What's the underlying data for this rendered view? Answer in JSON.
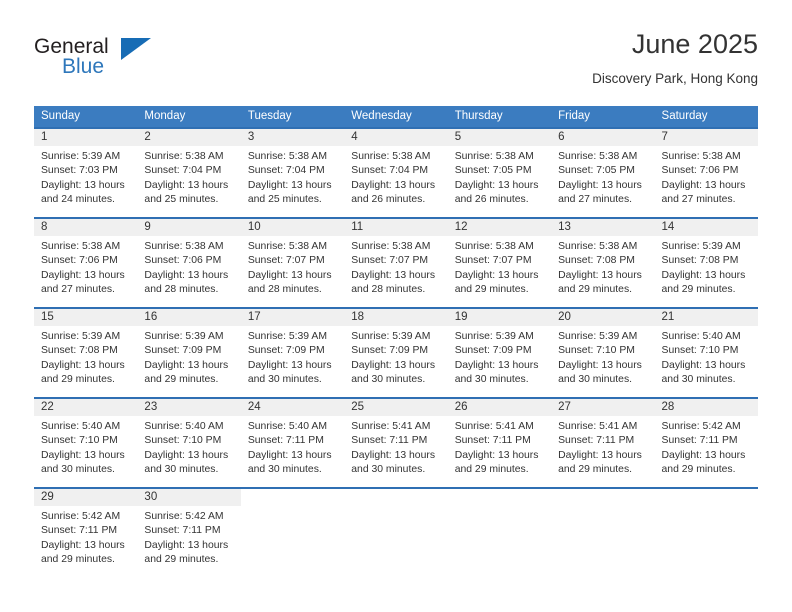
{
  "brand": {
    "name_part1": "General",
    "name_part2": "Blue",
    "triangle_color": "#176cb5",
    "blue_color": "#2e77bb"
  },
  "header": {
    "title": "June 2025",
    "subtitle": "Discovery Park, Hong Kong"
  },
  "theme": {
    "header_bg": "#3b7cc0",
    "row_divider": "#2f6fb3",
    "daynum_band_bg": "#f0f0f0",
    "text": "#333333"
  },
  "weekday_headers": [
    "Sunday",
    "Monday",
    "Tuesday",
    "Wednesday",
    "Thursday",
    "Friday",
    "Saturday"
  ],
  "weeks": [
    {
      "days": [
        {
          "date": "1",
          "sunrise": "Sunrise: 5:39 AM",
          "sunset": "Sunset: 7:03 PM",
          "daylight_line1": "Daylight: 13 hours",
          "daylight_line2": "and 24 minutes."
        },
        {
          "date": "2",
          "sunrise": "Sunrise: 5:38 AM",
          "sunset": "Sunset: 7:04 PM",
          "daylight_line1": "Daylight: 13 hours",
          "daylight_line2": "and 25 minutes."
        },
        {
          "date": "3",
          "sunrise": "Sunrise: 5:38 AM",
          "sunset": "Sunset: 7:04 PM",
          "daylight_line1": "Daylight: 13 hours",
          "daylight_line2": "and 25 minutes."
        },
        {
          "date": "4",
          "sunrise": "Sunrise: 5:38 AM",
          "sunset": "Sunset: 7:04 PM",
          "daylight_line1": "Daylight: 13 hours",
          "daylight_line2": "and 26 minutes."
        },
        {
          "date": "5",
          "sunrise": "Sunrise: 5:38 AM",
          "sunset": "Sunset: 7:05 PM",
          "daylight_line1": "Daylight: 13 hours",
          "daylight_line2": "and 26 minutes."
        },
        {
          "date": "6",
          "sunrise": "Sunrise: 5:38 AM",
          "sunset": "Sunset: 7:05 PM",
          "daylight_line1": "Daylight: 13 hours",
          "daylight_line2": "and 27 minutes."
        },
        {
          "date": "7",
          "sunrise": "Sunrise: 5:38 AM",
          "sunset": "Sunset: 7:06 PM",
          "daylight_line1": "Daylight: 13 hours",
          "daylight_line2": "and 27 minutes."
        }
      ]
    },
    {
      "days": [
        {
          "date": "8",
          "sunrise": "Sunrise: 5:38 AM",
          "sunset": "Sunset: 7:06 PM",
          "daylight_line1": "Daylight: 13 hours",
          "daylight_line2": "and 27 minutes."
        },
        {
          "date": "9",
          "sunrise": "Sunrise: 5:38 AM",
          "sunset": "Sunset: 7:06 PM",
          "daylight_line1": "Daylight: 13 hours",
          "daylight_line2": "and 28 minutes."
        },
        {
          "date": "10",
          "sunrise": "Sunrise: 5:38 AM",
          "sunset": "Sunset: 7:07 PM",
          "daylight_line1": "Daylight: 13 hours",
          "daylight_line2": "and 28 minutes."
        },
        {
          "date": "11",
          "sunrise": "Sunrise: 5:38 AM",
          "sunset": "Sunset: 7:07 PM",
          "daylight_line1": "Daylight: 13 hours",
          "daylight_line2": "and 28 minutes."
        },
        {
          "date": "12",
          "sunrise": "Sunrise: 5:38 AM",
          "sunset": "Sunset: 7:07 PM",
          "daylight_line1": "Daylight: 13 hours",
          "daylight_line2": "and 29 minutes."
        },
        {
          "date": "13",
          "sunrise": "Sunrise: 5:38 AM",
          "sunset": "Sunset: 7:08 PM",
          "daylight_line1": "Daylight: 13 hours",
          "daylight_line2": "and 29 minutes."
        },
        {
          "date": "14",
          "sunrise": "Sunrise: 5:39 AM",
          "sunset": "Sunset: 7:08 PM",
          "daylight_line1": "Daylight: 13 hours",
          "daylight_line2": "and 29 minutes."
        }
      ]
    },
    {
      "days": [
        {
          "date": "15",
          "sunrise": "Sunrise: 5:39 AM",
          "sunset": "Sunset: 7:08 PM",
          "daylight_line1": "Daylight: 13 hours",
          "daylight_line2": "and 29 minutes."
        },
        {
          "date": "16",
          "sunrise": "Sunrise: 5:39 AM",
          "sunset": "Sunset: 7:09 PM",
          "daylight_line1": "Daylight: 13 hours",
          "daylight_line2": "and 29 minutes."
        },
        {
          "date": "17",
          "sunrise": "Sunrise: 5:39 AM",
          "sunset": "Sunset: 7:09 PM",
          "daylight_line1": "Daylight: 13 hours",
          "daylight_line2": "and 30 minutes."
        },
        {
          "date": "18",
          "sunrise": "Sunrise: 5:39 AM",
          "sunset": "Sunset: 7:09 PM",
          "daylight_line1": "Daylight: 13 hours",
          "daylight_line2": "and 30 minutes."
        },
        {
          "date": "19",
          "sunrise": "Sunrise: 5:39 AM",
          "sunset": "Sunset: 7:09 PM",
          "daylight_line1": "Daylight: 13 hours",
          "daylight_line2": "and 30 minutes."
        },
        {
          "date": "20",
          "sunrise": "Sunrise: 5:39 AM",
          "sunset": "Sunset: 7:10 PM",
          "daylight_line1": "Daylight: 13 hours",
          "daylight_line2": "and 30 minutes."
        },
        {
          "date": "21",
          "sunrise": "Sunrise: 5:40 AM",
          "sunset": "Sunset: 7:10 PM",
          "daylight_line1": "Daylight: 13 hours",
          "daylight_line2": "and 30 minutes."
        }
      ]
    },
    {
      "days": [
        {
          "date": "22",
          "sunrise": "Sunrise: 5:40 AM",
          "sunset": "Sunset: 7:10 PM",
          "daylight_line1": "Daylight: 13 hours",
          "daylight_line2": "and 30 minutes."
        },
        {
          "date": "23",
          "sunrise": "Sunrise: 5:40 AM",
          "sunset": "Sunset: 7:10 PM",
          "daylight_line1": "Daylight: 13 hours",
          "daylight_line2": "and 30 minutes."
        },
        {
          "date": "24",
          "sunrise": "Sunrise: 5:40 AM",
          "sunset": "Sunset: 7:11 PM",
          "daylight_line1": "Daylight: 13 hours",
          "daylight_line2": "and 30 minutes."
        },
        {
          "date": "25",
          "sunrise": "Sunrise: 5:41 AM",
          "sunset": "Sunset: 7:11 PM",
          "daylight_line1": "Daylight: 13 hours",
          "daylight_line2": "and 30 minutes."
        },
        {
          "date": "26",
          "sunrise": "Sunrise: 5:41 AM",
          "sunset": "Sunset: 7:11 PM",
          "daylight_line1": "Daylight: 13 hours",
          "daylight_line2": "and 29 minutes."
        },
        {
          "date": "27",
          "sunrise": "Sunrise: 5:41 AM",
          "sunset": "Sunset: 7:11 PM",
          "daylight_line1": "Daylight: 13 hours",
          "daylight_line2": "and 29 minutes."
        },
        {
          "date": "28",
          "sunrise": "Sunrise: 5:42 AM",
          "sunset": "Sunset: 7:11 PM",
          "daylight_line1": "Daylight: 13 hours",
          "daylight_line2": "and 29 minutes."
        }
      ]
    },
    {
      "days": [
        {
          "date": "29",
          "sunrise": "Sunrise: 5:42 AM",
          "sunset": "Sunset: 7:11 PM",
          "daylight_line1": "Daylight: 13 hours",
          "daylight_line2": "and 29 minutes."
        },
        {
          "date": "30",
          "sunrise": "Sunrise: 5:42 AM",
          "sunset": "Sunset: 7:11 PM",
          "daylight_line1": "Daylight: 13 hours",
          "daylight_line2": "and 29 minutes."
        },
        {
          "date": "",
          "sunrise": "",
          "sunset": "",
          "daylight_line1": "",
          "daylight_line2": ""
        },
        {
          "date": "",
          "sunrise": "",
          "sunset": "",
          "daylight_line1": "",
          "daylight_line2": ""
        },
        {
          "date": "",
          "sunrise": "",
          "sunset": "",
          "daylight_line1": "",
          "daylight_line2": ""
        },
        {
          "date": "",
          "sunrise": "",
          "sunset": "",
          "daylight_line1": "",
          "daylight_line2": ""
        },
        {
          "date": "",
          "sunrise": "",
          "sunset": "",
          "daylight_line1": "",
          "daylight_line2": ""
        }
      ]
    }
  ]
}
